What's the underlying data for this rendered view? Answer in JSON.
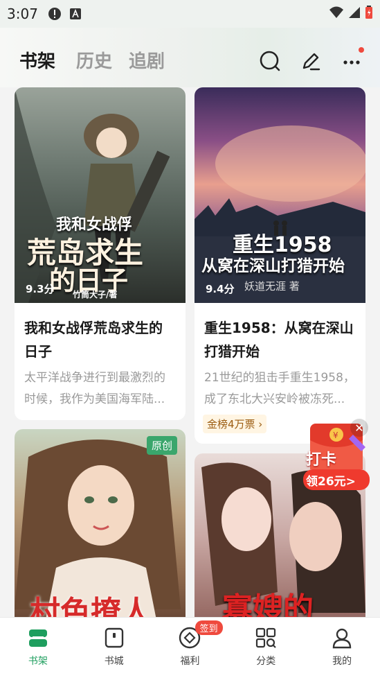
{
  "status": {
    "time": "3:07"
  },
  "header": {
    "tabs": [
      "书架",
      "历史",
      "追剧"
    ]
  },
  "books": [
    {
      "score": "9.3分",
      "title": "我和女战俘荒岛求生的日子",
      "desc": "太平洋战争进行到最激烈的时候，我作为美国海军陆...",
      "cover_title": "我和女战俘",
      "cover_title2": "荒岛求生",
      "cover_title3": "的日子",
      "cover_author": "竹筒大子/著"
    },
    {
      "score": "9.4分",
      "author": "妖道无涯 著",
      "title": "重生1958：从窝在深山打猎开始",
      "desc": "21世纪的狙击手重生1958，成了东北大兴安岭被冻死...",
      "rank": "金榜4万票 ›",
      "cover_title": "重生1958",
      "cover_title2": "从窝在深山打猎开始"
    },
    {
      "badge": "原创",
      "cover_title": "村色撩人"
    },
    {
      "cover_title": "寡嫂的"
    }
  ],
  "checkin": {
    "line1": "打卡",
    "line2": "领26元>"
  },
  "nav": [
    {
      "label": "书架",
      "icon": "bookshelf-icon"
    },
    {
      "label": "书城",
      "icon": "bookstore-icon"
    },
    {
      "label": "福利",
      "icon": "welfare-icon",
      "badge": "签到"
    },
    {
      "label": "分类",
      "icon": "category-icon"
    },
    {
      "label": "我的",
      "icon": "profile-icon"
    }
  ],
  "colors": {
    "accent": "#1e9e5e",
    "red": "#ef4a3e"
  }
}
